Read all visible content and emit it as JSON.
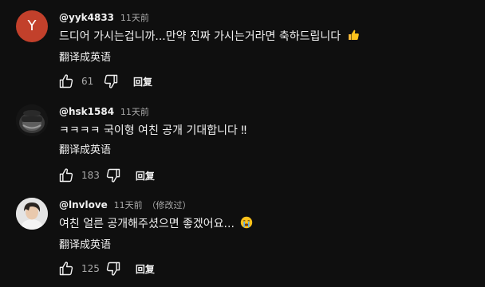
{
  "comments": [
    {
      "avatar_letter": "Y",
      "avatar_color": "#c2402b",
      "author": "@yyk4833",
      "time": "11天前",
      "edited": "",
      "text": "드디어 가시는겁니까...만약 진짜 가시는거라면 축하드립니다",
      "emoji": "thumbs-up",
      "translate": "翻译成英语",
      "likes": "61",
      "reply": "回复"
    },
    {
      "avatar_letter": "",
      "author": "@hsk1584",
      "time": "11天前",
      "edited": "",
      "text": "ㅋㅋㅋㅋ 국이형 여친 공개 기대합니다 ‼",
      "emoji": "",
      "translate": "翻译成英语",
      "likes": "183",
      "reply": "回复"
    },
    {
      "avatar_letter": "",
      "author": "@lnvlove",
      "time": "11天前",
      "edited": "（修改过）",
      "text": "여친 얼른 공개해주셨으면 좋겠어요...",
      "emoji": "crying-face",
      "translate": "翻译成英语",
      "likes": "125",
      "reply": "回复"
    }
  ],
  "colors": {
    "background": "#0f0f0f",
    "text_primary": "#f1f1f1",
    "text_secondary": "#aaaaaa"
  },
  "icons": [
    "thumbs-up-icon",
    "thumbs-down-icon"
  ]
}
